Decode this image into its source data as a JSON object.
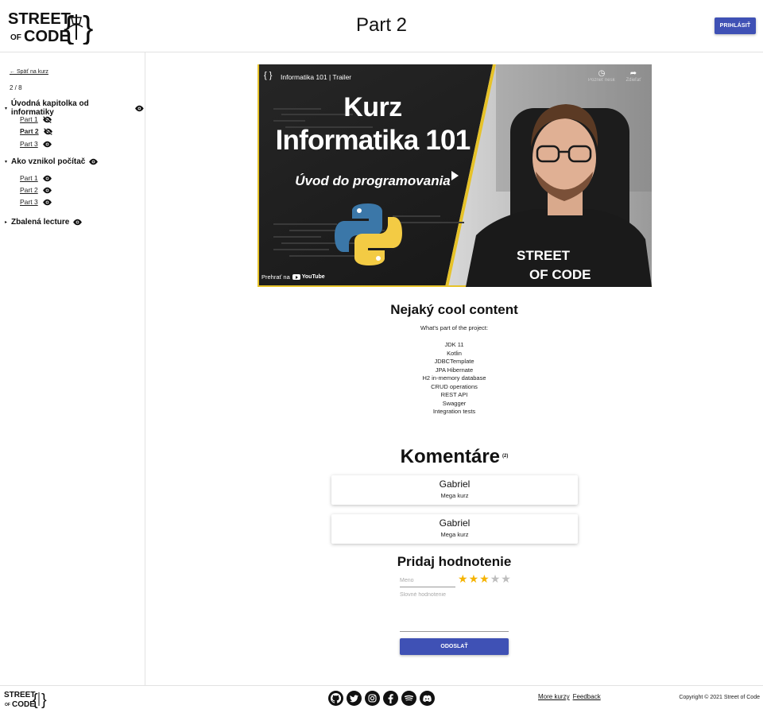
{
  "header": {
    "logo_line1": "STREET",
    "logo_line2a": "OF",
    "logo_line2b": "CODE",
    "title": "Part 2",
    "login_label": "PRIHLÁSIŤ"
  },
  "sidebar": {
    "back_label": "← Späť na kurz",
    "progress": "2 / 8",
    "sections": [
      {
        "title": "Úvodná kapitolka od informatiky",
        "parts": [
          {
            "label": "Part 1"
          },
          {
            "label": "Part 2"
          },
          {
            "label": "Part 3"
          }
        ]
      },
      {
        "title": "Ako vznikol počítač",
        "parts": [
          {
            "label": "Part 1"
          },
          {
            "label": "Part 2"
          },
          {
            "label": "Part 3"
          }
        ]
      },
      {
        "title": "Zbalená lecture",
        "parts": []
      }
    ]
  },
  "video": {
    "title": "Informatika 101 | Trailer",
    "heading1": "Kurz",
    "heading2": "Informatika 101",
    "heading3": "Úvod do programovania",
    "watch_later": "Pozrieť neskôr",
    "share": "Zdieľať",
    "play_on": "Prehrať na",
    "youtube": "YouTube",
    "shirt_line1": "STREET",
    "shirt_line2": "OF CODE"
  },
  "content": {
    "title": "Nejaký cool content",
    "subtitle": "What's part of the project:",
    "items": [
      "JDK 11",
      "Kotlin",
      "JDBCTemplate",
      "JPA Hibernate",
      "H2 in-memory database",
      "CRUD operations",
      "REST API",
      "Swagger",
      "Integration tests"
    ]
  },
  "comments": {
    "title": "Komentáre",
    "count": "(2)",
    "list": [
      {
        "name": "Gabriel",
        "text": "Mega kurz"
      },
      {
        "name": "Gabriel",
        "text": "Mega kurz"
      }
    ]
  },
  "rating": {
    "title": "Pridaj hodnotenie",
    "name_placeholder": "Meno",
    "review_placeholder": "Slovné hodnotenie",
    "stars_value": 3,
    "stars_max": 5,
    "star_color": "#f5b301",
    "star_empty_color": "#bdbdbd",
    "submit_label": "ODOSLAŤ"
  },
  "footer": {
    "social_icons": [
      "github-icon",
      "twitter-icon",
      "instagram-icon",
      "facebook-icon",
      "spotify-icon",
      "discord-icon"
    ],
    "link_more": "More kurzy",
    "link_feedback": "Feedback",
    "copyright": "Copyright © 2021 Street of Code"
  },
  "colors": {
    "primary": "#3f51b5",
    "video_border": "#e6c229"
  }
}
